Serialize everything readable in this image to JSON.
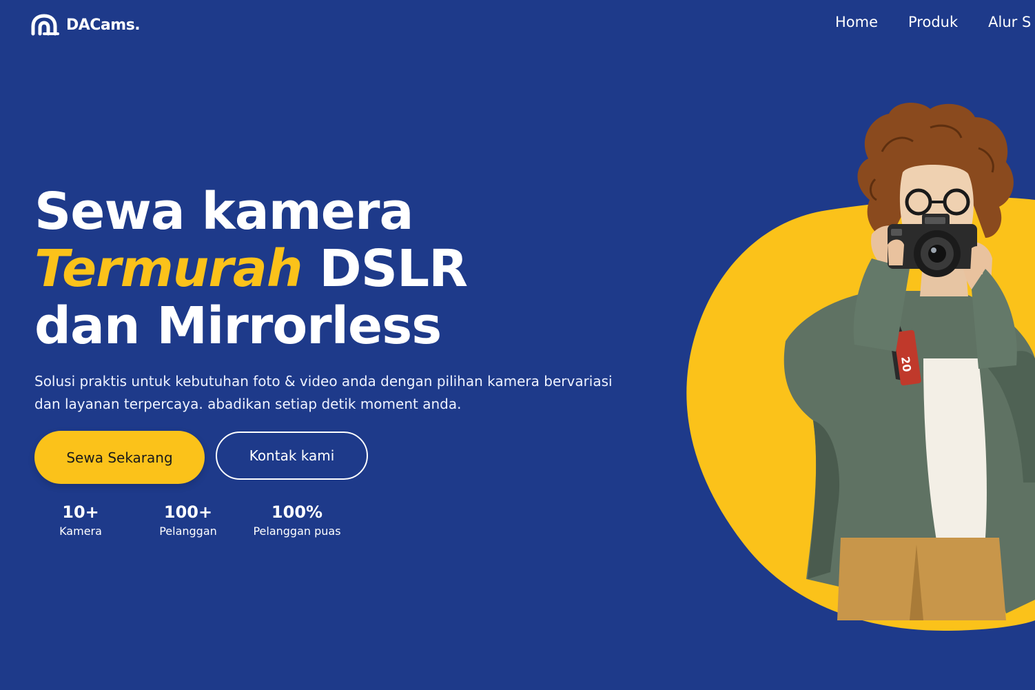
{
  "brand": {
    "name": "DACams.",
    "logo_icon": "dacams-logo-icon"
  },
  "nav": {
    "items": [
      {
        "label": "Home"
      },
      {
        "label": "Produk"
      },
      {
        "label": "Alur S"
      }
    ]
  },
  "hero": {
    "title_line1": "Sewa kamera",
    "title_accent": "Termurah",
    "title_line2_rest": " DSLR",
    "title_line3": "dan Mirrorless",
    "subtitle": "Solusi praktis untuk kebutuhan foto & video anda dengan pilihan kamera bervariasi dan layanan terpercaya. abadikan setiap detik moment anda.",
    "primary_button": "Sewa Sekarang",
    "secondary_button": "Kontak kami"
  },
  "stats": [
    {
      "value": "10+",
      "label": "Kamera"
    },
    {
      "value": "100+",
      "label": "Pelanggan"
    },
    {
      "value": "100%",
      "label": "Pelanggan puas"
    }
  ],
  "illustration": {
    "subject": "photographer-with-camera-illustration",
    "camera_strap_text": "20"
  },
  "colors": {
    "background": "#1e3a8a",
    "accent_yellow": "#fbc21a",
    "text_white": "#ffffff"
  }
}
